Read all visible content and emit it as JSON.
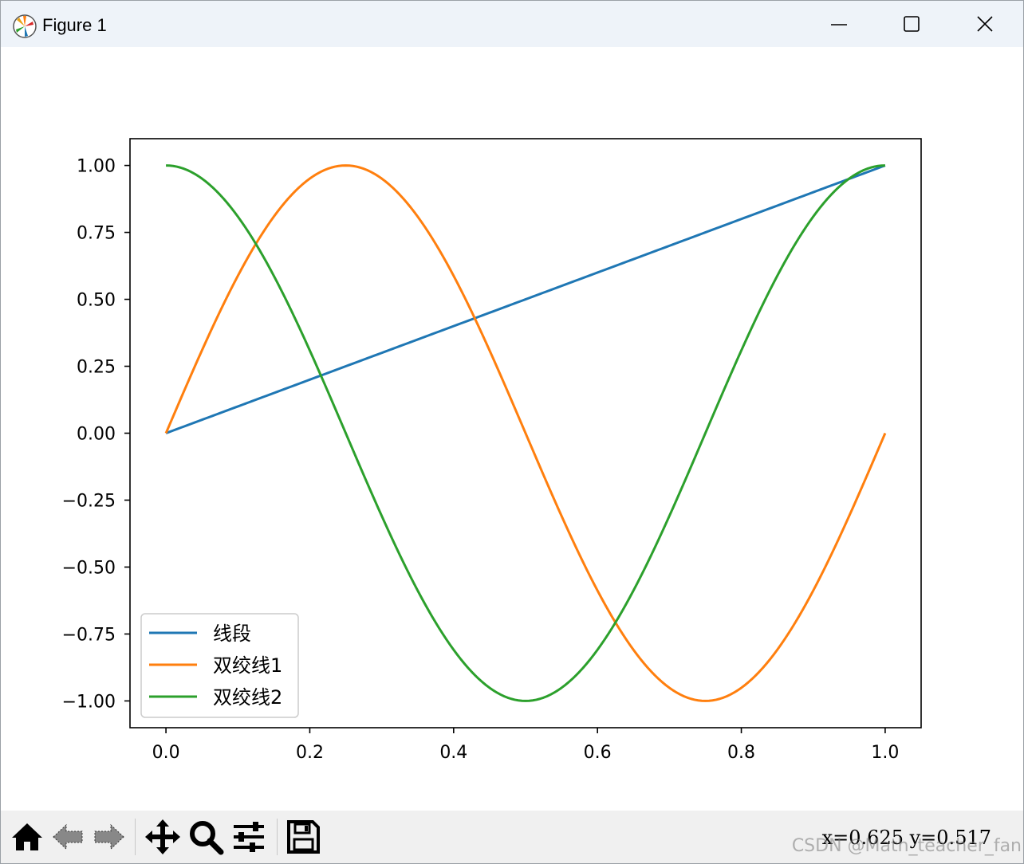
{
  "window": {
    "title": "Figure 1",
    "app_icon": "matplotlib-icon",
    "controls": [
      "minimize-icon",
      "maximize-icon",
      "close-icon"
    ]
  },
  "toolbar": {
    "tools": [
      "home-icon",
      "back-icon",
      "forward-icon",
      "pan-icon",
      "zoom-icon",
      "configure-subplots-icon",
      "save-icon"
    ],
    "coords": "x=0.625 y=0.517"
  },
  "watermark": "CSDN @Math_teacher_fan",
  "colors": {
    "series_blue": "#1f77b4",
    "series_orange": "#ff7f0e",
    "series_green": "#2ca02c",
    "titlebar_bg": "#eef3f9",
    "toolbar_bg": "#f0f0f0"
  },
  "chart_data": {
    "type": "line",
    "title": "",
    "xlabel": "",
    "ylabel": "",
    "xlim": [
      -0.05,
      1.05
    ],
    "ylim": [
      -1.1,
      1.1
    ],
    "xticks": [
      0.0,
      0.2,
      0.4,
      0.6,
      0.8,
      1.0
    ],
    "xtick_labels": [
      "0.0",
      "0.2",
      "0.4",
      "0.6",
      "0.8",
      "1.0"
    ],
    "yticks": [
      1.0,
      0.75,
      0.5,
      0.25,
      0.0,
      -0.25,
      -0.5,
      -0.75,
      -1.0
    ],
    "ytick_labels": [
      "1.00",
      "0.75",
      "0.50",
      "0.25",
      "0.00",
      "−0.25",
      "−0.50",
      "−0.75",
      "−1.00"
    ],
    "grid": false,
    "legend_position": "lower-left",
    "x": [
      0.0,
      0.05,
      0.1,
      0.15,
      0.2,
      0.25,
      0.3,
      0.35,
      0.4,
      0.45,
      0.5,
      0.55,
      0.6,
      0.65,
      0.7,
      0.75,
      0.8,
      0.85,
      0.9,
      0.95,
      1.0
    ],
    "series": [
      {
        "name": "线段",
        "color": "#1f77b4",
        "values": [
          0.0,
          0.05,
          0.1,
          0.15,
          0.2,
          0.25,
          0.3,
          0.35,
          0.4,
          0.45,
          0.5,
          0.55,
          0.6,
          0.65,
          0.7,
          0.75,
          0.8,
          0.85,
          0.9,
          0.95,
          1.0
        ]
      },
      {
        "name": "双绞线1",
        "color": "#ff7f0e",
        "values": [
          0.0,
          0.309,
          0.588,
          0.809,
          0.951,
          1.0,
          0.951,
          0.809,
          0.588,
          0.309,
          0.0,
          -0.309,
          -0.588,
          -0.809,
          -0.951,
          -1.0,
          -0.951,
          -0.809,
          -0.588,
          -0.309,
          0.0
        ]
      },
      {
        "name": "双绞线2",
        "color": "#2ca02c",
        "values": [
          1.0,
          0.951,
          0.809,
          0.588,
          0.309,
          0.0,
          -0.309,
          -0.588,
          -0.809,
          -0.951,
          -1.0,
          -0.951,
          -0.809,
          -0.588,
          -0.309,
          0.0,
          0.309,
          0.588,
          0.809,
          0.951,
          1.0
        ]
      }
    ]
  }
}
